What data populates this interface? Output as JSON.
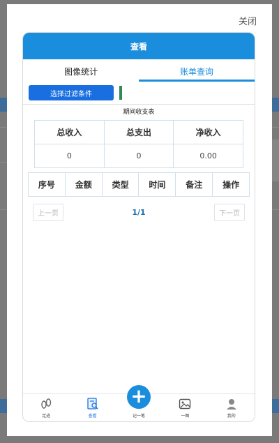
{
  "modal": {
    "close_label": "关闭"
  },
  "header": {
    "title": "查看"
  },
  "tabs": [
    {
      "label": "图像统计",
      "active": false
    },
    {
      "label": "账单查询",
      "active": true
    }
  ],
  "filter": {
    "button_label": "选择过滤条件"
  },
  "summary": {
    "title": "期间收支表",
    "headers": [
      "总收入",
      "总支出",
      "净收入"
    ],
    "values": [
      "0",
      "0",
      "0.00"
    ]
  },
  "records": {
    "headers": [
      "序号",
      "金额",
      "类型",
      "时间",
      "备注",
      "操作"
    ]
  },
  "pager": {
    "prev_label": "上一页",
    "page_info": "1/1",
    "next_label": "下一页"
  },
  "bottom_nav": [
    {
      "label": "足迹",
      "icon": "footprint-icon"
    },
    {
      "label": "查看",
      "icon": "search-doc-icon",
      "active": true
    },
    {
      "label": "记一笔",
      "icon": "plus-icon"
    },
    {
      "label": "一图",
      "icon": "image-icon"
    },
    {
      "label": "我的",
      "icon": "user-icon"
    }
  ],
  "colors": {
    "primary": "#1a8ddc",
    "filter_button": "#1a6fe0",
    "accent_bar": "#2e8b57"
  }
}
